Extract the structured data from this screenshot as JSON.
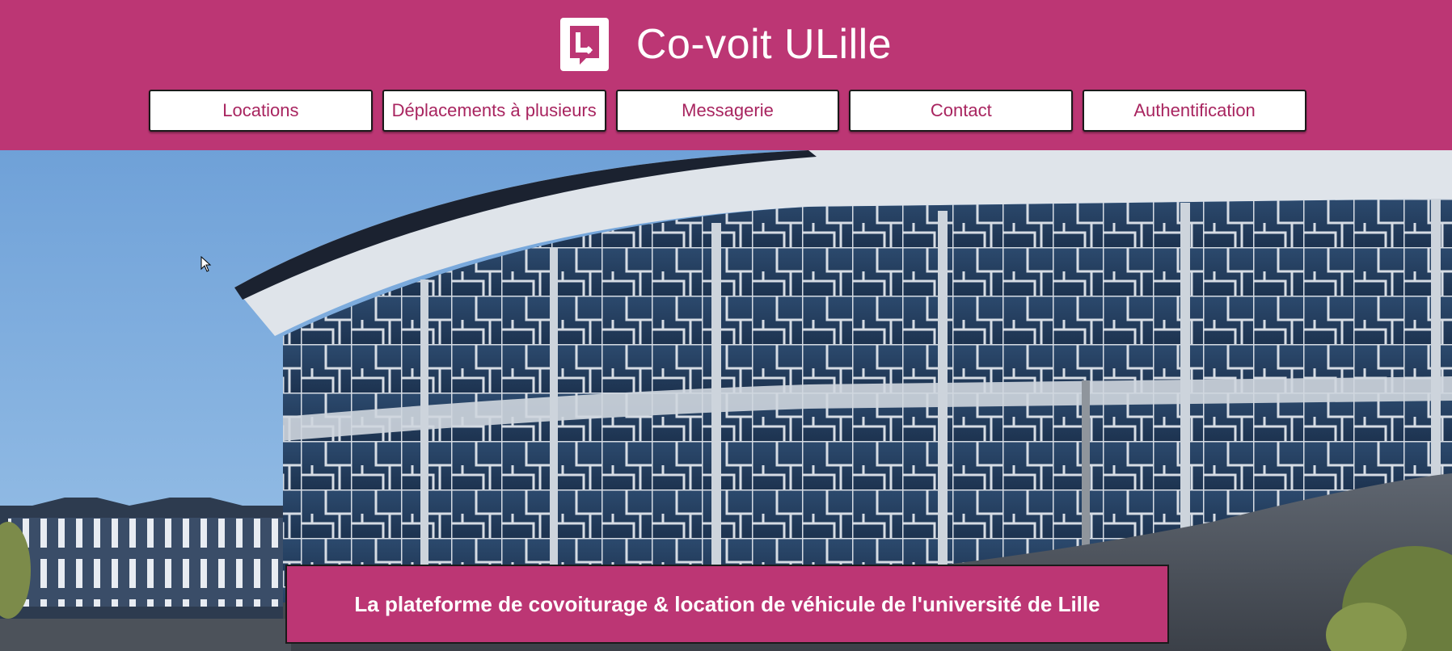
{
  "header": {
    "title": "Co-voit ULille",
    "background_color": "#bc3674",
    "logo_icon": "ulille-logo-icon"
  },
  "nav": {
    "items": [
      {
        "label": "Locations"
      },
      {
        "label": "Déplacements à plusieurs"
      },
      {
        "label": "Messagerie"
      },
      {
        "label": "Contact"
      },
      {
        "label": "Authentification"
      }
    ],
    "text_color": "#a8245f"
  },
  "hero": {
    "tagline": "La plateforme de covoiturage & location de véhicule de l'université de Lille"
  }
}
